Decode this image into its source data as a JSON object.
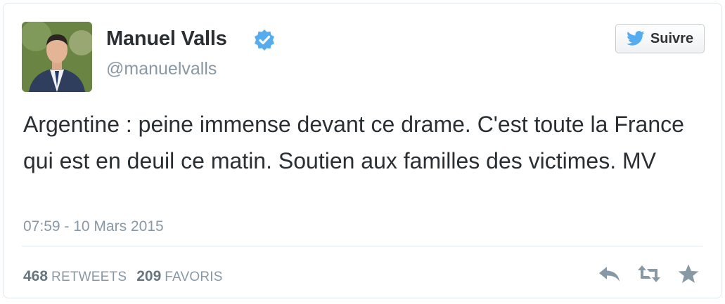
{
  "author": {
    "name": "Manuel Valls",
    "handle": "@manuelvalls",
    "verified": true
  },
  "follow_button": {
    "label": "Suivre",
    "icon": "twitter-bird-icon"
  },
  "tweet": {
    "text": "Argentine : peine immense devant ce drame. C'est toute la France qui est en deuil ce matin. Soutien aux familles des victimes. MV",
    "timestamp": "07:59 - 10 Mars 2015"
  },
  "stats": {
    "retweets_count": "468",
    "retweets_label": "RETWEETS",
    "favorites_count": "209",
    "favorites_label": "FAVORIS"
  },
  "actions": [
    {
      "icon": "reply-icon"
    },
    {
      "icon": "retweet-icon"
    },
    {
      "icon": "favorite-star-icon"
    }
  ],
  "colors": {
    "text": "#292f33",
    "secondary": "#8899a6",
    "verified_blue": "#55acee",
    "bird_blue": "#55acee",
    "icon_gray": "#8899a6"
  }
}
